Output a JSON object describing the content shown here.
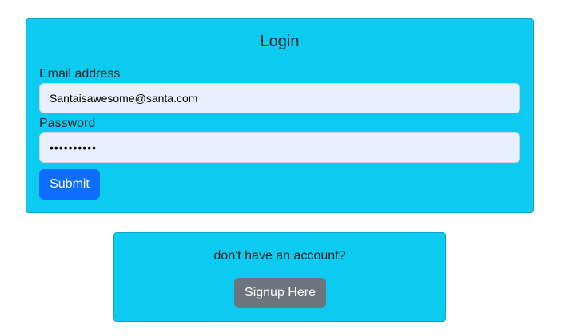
{
  "login": {
    "title": "Login",
    "email_label": "Email address",
    "email_value": "Santaisawesome@santa.com",
    "password_label": "Password",
    "password_value": "••••••••••",
    "submit_label": "Submit"
  },
  "signup": {
    "prompt": "don't have an account?",
    "button_label": "Signup Here"
  },
  "colors": {
    "card_background": "#0dcaf0",
    "primary_button": "#0d6efd",
    "secondary_button": "#6c757d",
    "input_background": "#e8f0fe"
  }
}
